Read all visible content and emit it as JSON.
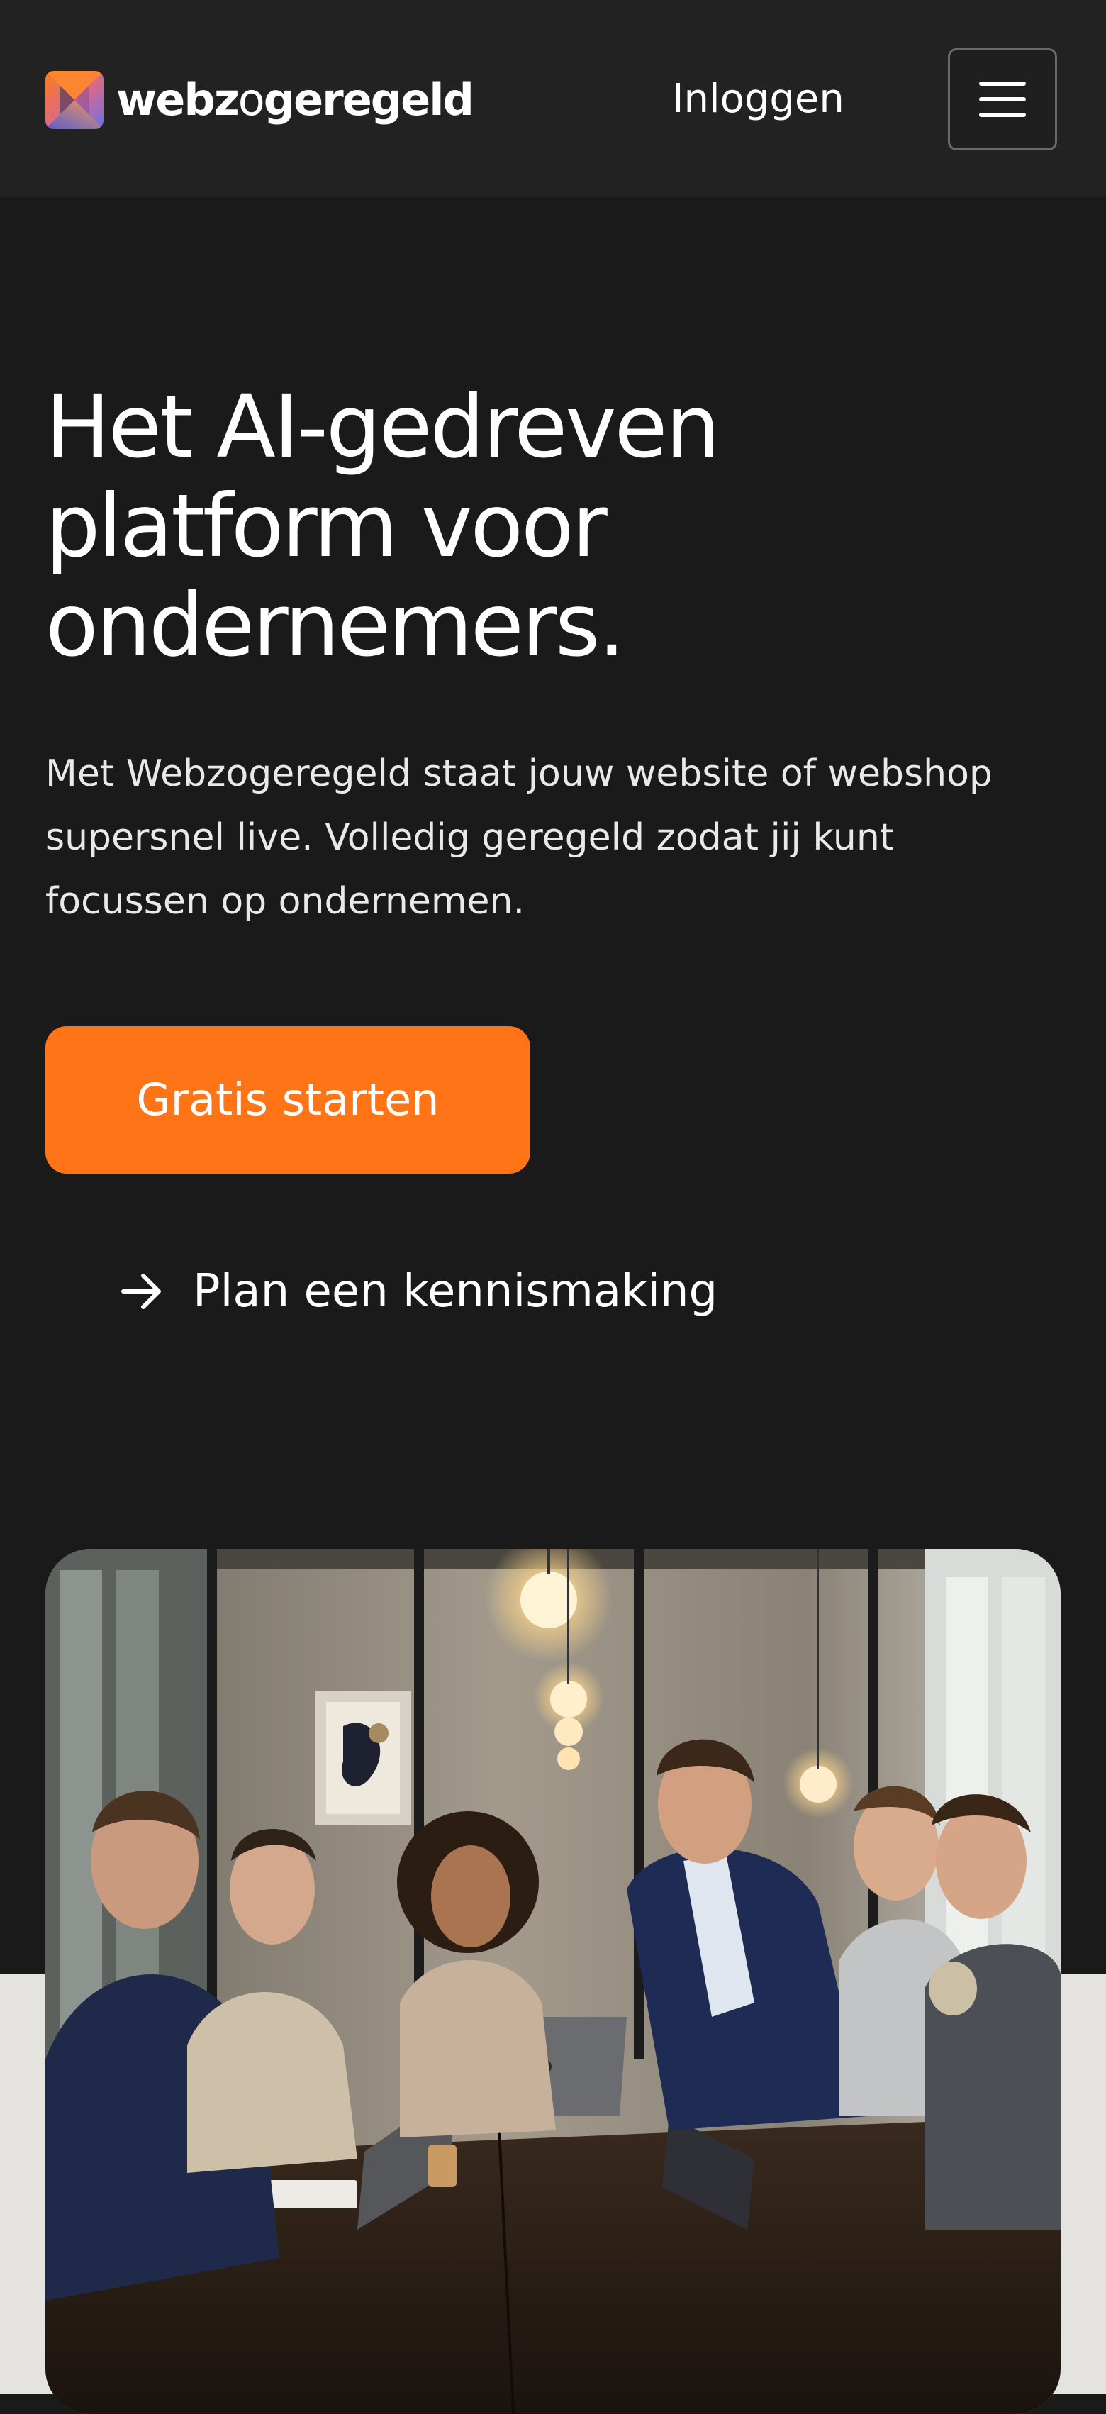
{
  "header": {
    "logo_bold_1": "webz",
    "logo_light": "o",
    "logo_bold_2": "geregeld",
    "login_label": "Inloggen",
    "menu_icon": "hamburger-menu-icon"
  },
  "hero": {
    "title": "Het AI-gedreven platform voor ondernemers.",
    "description": "Met Webzogeregeld staat jouw website of webshop supersnel live. Volledig geregeld zodat jij kunt focussen op ondernemen.",
    "primary_cta": "Gratis starten",
    "secondary_cta": "Plan een kennismaking",
    "secondary_icon": "arrow-right-icon"
  },
  "image": {
    "subject": "team-meeting-photo"
  },
  "colors": {
    "background": "#1a1a1b",
    "header": "#222223",
    "accent": "#fe7417",
    "light_band": "#e5e3df"
  }
}
